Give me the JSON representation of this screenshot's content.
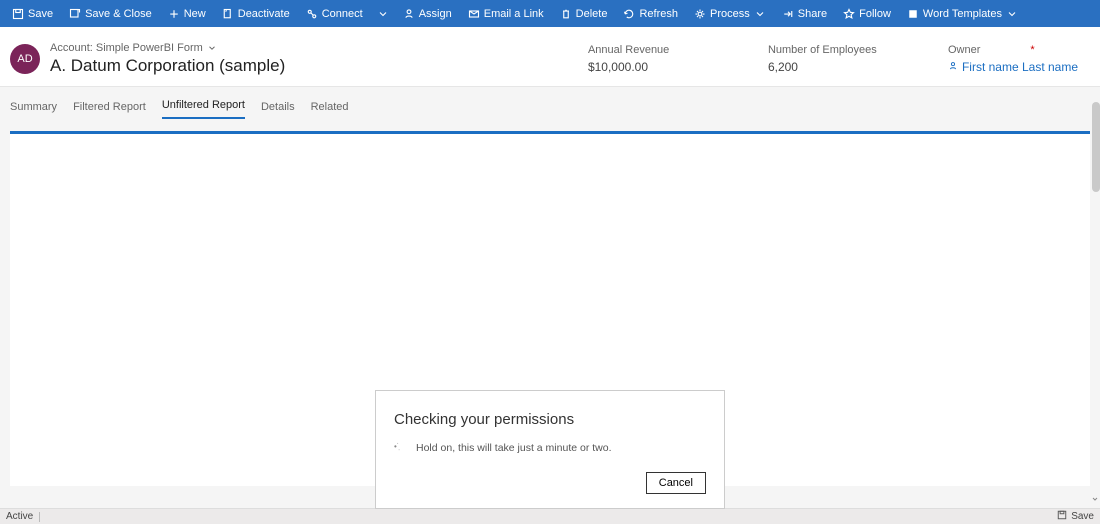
{
  "commands": {
    "save": "Save",
    "save_close": "Save & Close",
    "new": "New",
    "deactivate": "Deactivate",
    "connect": "Connect",
    "assign": "Assign",
    "email_link": "Email a Link",
    "delete": "Delete",
    "refresh": "Refresh",
    "process": "Process",
    "share": "Share",
    "follow": "Follow",
    "word_templates": "Word Templates"
  },
  "header": {
    "avatar_initials": "AD",
    "breadcrumb": "Account: Simple PowerBI Form",
    "title": "A. Datum Corporation (sample)"
  },
  "fields": {
    "annual_revenue_label": "Annual Revenue",
    "annual_revenue_value": "$10,000.00",
    "employees_label": "Number of Employees",
    "employees_value": "6,200",
    "owner_label": "Owner",
    "owner_value": "First name Last name"
  },
  "tabs": {
    "summary": "Summary",
    "filtered": "Filtered Report",
    "unfiltered": "Unfiltered Report",
    "details": "Details",
    "related": "Related"
  },
  "modal": {
    "title": "Checking your permissions",
    "body": "Hold on, this will take just a minute or two.",
    "cancel": "Cancel"
  },
  "statusbar": {
    "active": "Active",
    "save": "Save"
  }
}
